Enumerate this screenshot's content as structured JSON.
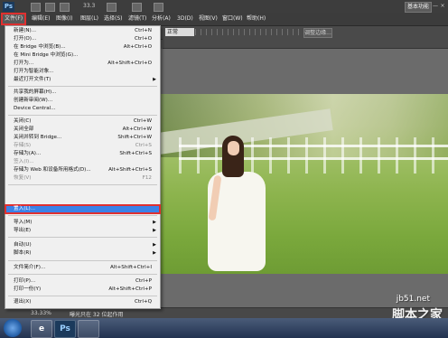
{
  "titlebar": {
    "ps_logo": "Ps",
    "zoom": "33.3",
    "workspace_button": "基本功能",
    "window_buttons": [
      "—",
      "□",
      "×"
    ]
  },
  "menubar": {
    "items": [
      "文件(F)",
      "编辑(E)",
      "图像(I)",
      "图层(L)",
      "选择(S)",
      "滤镜(T)",
      "分析(A)",
      "3D(D)",
      "视图(V)",
      "窗口(W)",
      "帮助(H)"
    ]
  },
  "options": {
    "mode_select": "正常",
    "refine_button": "调整边缘..."
  },
  "file_menu": {
    "items": [
      {
        "label": "新建(N)...",
        "shortcut": "Ctrl+N"
      },
      {
        "label": "打开(O)...",
        "shortcut": "Ctrl+O"
      },
      {
        "label": "在 Bridge 中浏览(B)...",
        "shortcut": "Alt+Ctrl+O"
      },
      {
        "label": "在 Mini Bridge 中浏览(G)...",
        "shortcut": ""
      },
      {
        "label": "打开为...",
        "shortcut": "Alt+Shift+Ctrl+O"
      },
      {
        "label": "打开为智能对象...",
        "shortcut": ""
      },
      {
        "label": "最近打开文件(T)",
        "shortcut": ""
      },
      {
        "label": "共享我的屏幕(H)...",
        "shortcut": ""
      },
      {
        "label": "创建新审阅(W)...",
        "shortcut": ""
      },
      {
        "label": "Device Central...",
        "shortcut": ""
      },
      {
        "label": "关闭(C)",
        "shortcut": "Ctrl+W"
      },
      {
        "label": "关闭全部",
        "shortcut": "Alt+Ctrl+W"
      },
      {
        "label": "关闭并转到 Bridge...",
        "shortcut": "Shift+Ctrl+W"
      },
      {
        "label": "存储(S)",
        "shortcut": "Ctrl+S"
      },
      {
        "label": "存储为(A)...",
        "shortcut": "Shift+Ctrl+S"
      },
      {
        "label": "签入(I)...",
        "shortcut": ""
      },
      {
        "label": "存储为 Web 和设备所用格式(D)...",
        "shortcut": "Alt+Shift+Ctrl+S"
      },
      {
        "label": "恢复(V)",
        "shortcut": "F12"
      },
      {
        "label": "置入(L)...",
        "shortcut": ""
      },
      {
        "label": "导入(M)",
        "shortcut": ""
      },
      {
        "label": "导出(E)",
        "shortcut": ""
      },
      {
        "label": "自动(U)",
        "shortcut": ""
      },
      {
        "label": "脚本(R)",
        "shortcut": ""
      },
      {
        "label": "文件简介(F)...",
        "shortcut": "Alt+Shift+Ctrl+I"
      },
      {
        "label": "打印(P)...",
        "shortcut": "Ctrl+P"
      },
      {
        "label": "打印一份(Y)",
        "shortcut": "Alt+Shift+Ctrl+P"
      },
      {
        "label": "退出(X)",
        "shortcut": "Ctrl+Q"
      }
    ]
  },
  "status": {
    "zoom": "33.33%",
    "doc": "曝光只在 32 位起作用"
  },
  "taskbar": {
    "ps_label": "Ps"
  },
  "watermark": {
    "site": "jb51.net",
    "name": "脚本之家"
  }
}
